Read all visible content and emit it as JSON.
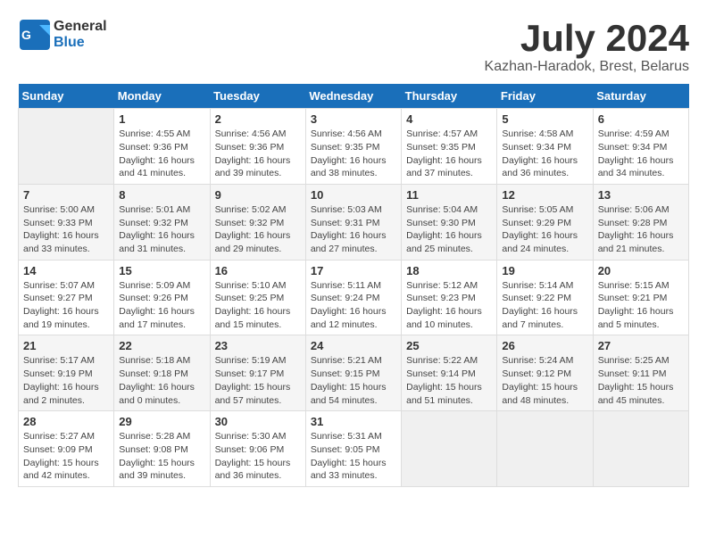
{
  "logo": {
    "line1": "General",
    "line2": "Blue"
  },
  "title": "July 2024",
  "location": "Kazhan-Haradok, Brest, Belarus",
  "days_of_week": [
    "Sunday",
    "Monday",
    "Tuesday",
    "Wednesday",
    "Thursday",
    "Friday",
    "Saturday"
  ],
  "weeks": [
    [
      {
        "day": "",
        "info": ""
      },
      {
        "day": "1",
        "info": "Sunrise: 4:55 AM\nSunset: 9:36 PM\nDaylight: 16 hours\nand 41 minutes."
      },
      {
        "day": "2",
        "info": "Sunrise: 4:56 AM\nSunset: 9:36 PM\nDaylight: 16 hours\nand 39 minutes."
      },
      {
        "day": "3",
        "info": "Sunrise: 4:56 AM\nSunset: 9:35 PM\nDaylight: 16 hours\nand 38 minutes."
      },
      {
        "day": "4",
        "info": "Sunrise: 4:57 AM\nSunset: 9:35 PM\nDaylight: 16 hours\nand 37 minutes."
      },
      {
        "day": "5",
        "info": "Sunrise: 4:58 AM\nSunset: 9:34 PM\nDaylight: 16 hours\nand 36 minutes."
      },
      {
        "day": "6",
        "info": "Sunrise: 4:59 AM\nSunset: 9:34 PM\nDaylight: 16 hours\nand 34 minutes."
      }
    ],
    [
      {
        "day": "7",
        "info": "Sunrise: 5:00 AM\nSunset: 9:33 PM\nDaylight: 16 hours\nand 33 minutes."
      },
      {
        "day": "8",
        "info": "Sunrise: 5:01 AM\nSunset: 9:32 PM\nDaylight: 16 hours\nand 31 minutes."
      },
      {
        "day": "9",
        "info": "Sunrise: 5:02 AM\nSunset: 9:32 PM\nDaylight: 16 hours\nand 29 minutes."
      },
      {
        "day": "10",
        "info": "Sunrise: 5:03 AM\nSunset: 9:31 PM\nDaylight: 16 hours\nand 27 minutes."
      },
      {
        "day": "11",
        "info": "Sunrise: 5:04 AM\nSunset: 9:30 PM\nDaylight: 16 hours\nand 25 minutes."
      },
      {
        "day": "12",
        "info": "Sunrise: 5:05 AM\nSunset: 9:29 PM\nDaylight: 16 hours\nand 24 minutes."
      },
      {
        "day": "13",
        "info": "Sunrise: 5:06 AM\nSunset: 9:28 PM\nDaylight: 16 hours\nand 21 minutes."
      }
    ],
    [
      {
        "day": "14",
        "info": "Sunrise: 5:07 AM\nSunset: 9:27 PM\nDaylight: 16 hours\nand 19 minutes."
      },
      {
        "day": "15",
        "info": "Sunrise: 5:09 AM\nSunset: 9:26 PM\nDaylight: 16 hours\nand 17 minutes."
      },
      {
        "day": "16",
        "info": "Sunrise: 5:10 AM\nSunset: 9:25 PM\nDaylight: 16 hours\nand 15 minutes."
      },
      {
        "day": "17",
        "info": "Sunrise: 5:11 AM\nSunset: 9:24 PM\nDaylight: 16 hours\nand 12 minutes."
      },
      {
        "day": "18",
        "info": "Sunrise: 5:12 AM\nSunset: 9:23 PM\nDaylight: 16 hours\nand 10 minutes."
      },
      {
        "day": "19",
        "info": "Sunrise: 5:14 AM\nSunset: 9:22 PM\nDaylight: 16 hours\nand 7 minutes."
      },
      {
        "day": "20",
        "info": "Sunrise: 5:15 AM\nSunset: 9:21 PM\nDaylight: 16 hours\nand 5 minutes."
      }
    ],
    [
      {
        "day": "21",
        "info": "Sunrise: 5:17 AM\nSunset: 9:19 PM\nDaylight: 16 hours\nand 2 minutes."
      },
      {
        "day": "22",
        "info": "Sunrise: 5:18 AM\nSunset: 9:18 PM\nDaylight: 16 hours\nand 0 minutes."
      },
      {
        "day": "23",
        "info": "Sunrise: 5:19 AM\nSunset: 9:17 PM\nDaylight: 15 hours\nand 57 minutes."
      },
      {
        "day": "24",
        "info": "Sunrise: 5:21 AM\nSunset: 9:15 PM\nDaylight: 15 hours\nand 54 minutes."
      },
      {
        "day": "25",
        "info": "Sunrise: 5:22 AM\nSunset: 9:14 PM\nDaylight: 15 hours\nand 51 minutes."
      },
      {
        "day": "26",
        "info": "Sunrise: 5:24 AM\nSunset: 9:12 PM\nDaylight: 15 hours\nand 48 minutes."
      },
      {
        "day": "27",
        "info": "Sunrise: 5:25 AM\nSunset: 9:11 PM\nDaylight: 15 hours\nand 45 minutes."
      }
    ],
    [
      {
        "day": "28",
        "info": "Sunrise: 5:27 AM\nSunset: 9:09 PM\nDaylight: 15 hours\nand 42 minutes."
      },
      {
        "day": "29",
        "info": "Sunrise: 5:28 AM\nSunset: 9:08 PM\nDaylight: 15 hours\nand 39 minutes."
      },
      {
        "day": "30",
        "info": "Sunrise: 5:30 AM\nSunset: 9:06 PM\nDaylight: 15 hours\nand 36 minutes."
      },
      {
        "day": "31",
        "info": "Sunrise: 5:31 AM\nSunset: 9:05 PM\nDaylight: 15 hours\nand 33 minutes."
      },
      {
        "day": "",
        "info": ""
      },
      {
        "day": "",
        "info": ""
      },
      {
        "day": "",
        "info": ""
      }
    ]
  ]
}
